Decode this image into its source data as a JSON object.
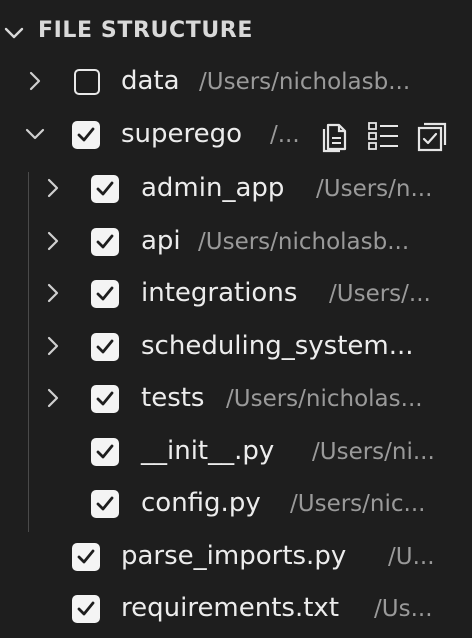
{
  "panel": {
    "title": "FILE STRUCTURE",
    "colors": {
      "background": "#1e1e1e",
      "text": "#ececec",
      "path": "#9a9a9a",
      "checkbox": "#f4f4f4"
    }
  },
  "rows": [
    {
      "name": "data",
      "path": "/Users/nicholasb...",
      "checked": false,
      "chevron": "chevron-right-icon"
    },
    {
      "name": "superego",
      "path": "/...",
      "checked": true,
      "chevron": "chevron-down-icon",
      "actions": [
        "copy-file-icon",
        "checklist-icon",
        "select-all-icon"
      ]
    },
    {
      "name": "admin_app",
      "path": "/Users/n...",
      "checked": true,
      "chevron": "chevron-right-icon"
    },
    {
      "name": "api",
      "path": "/Users/nicholasb...",
      "checked": true,
      "chevron": "chevron-right-icon"
    },
    {
      "name": "integrations",
      "path": "/Users/...",
      "checked": true,
      "chevron": "chevron-right-icon"
    },
    {
      "name": "scheduling_system...",
      "path": "",
      "checked": true,
      "chevron": "chevron-right-icon"
    },
    {
      "name": "tests",
      "path": "/Users/nicholas...",
      "checked": true,
      "chevron": "chevron-right-icon"
    },
    {
      "name": "__init__.py",
      "path": "/Users/ni...",
      "checked": true
    },
    {
      "name": "config.py",
      "path": "/Users/nic...",
      "checked": true
    },
    {
      "name": "parse_imports.py",
      "path": "/U...",
      "checked": true
    },
    {
      "name": "requirements.txt",
      "path": "/Us...",
      "checked": true
    }
  ]
}
